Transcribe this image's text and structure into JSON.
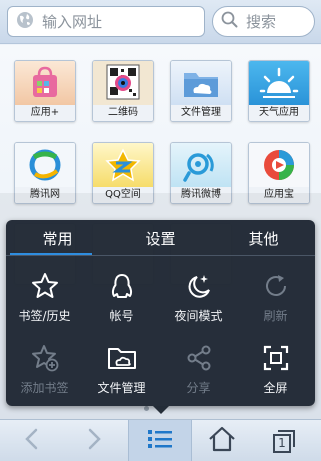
{
  "top_bar": {
    "url_placeholder": "输入网址",
    "search_placeholder": "搜索"
  },
  "home": {
    "apps": [
      {
        "label": "应用+",
        "icon": "app-plus-icon"
      },
      {
        "label": "二维码",
        "icon": "qr-code-icon"
      },
      {
        "label": "文件管理",
        "icon": "folder-cloud-icon"
      },
      {
        "label": "天气应用",
        "icon": "weather-sun-icon"
      },
      {
        "label": "腾讯网",
        "icon": "tencent-logo-icon"
      },
      {
        "label": "QQ空间",
        "icon": "qzone-star-icon"
      },
      {
        "label": "腾讯微博",
        "icon": "weibo-icon"
      },
      {
        "label": "应用宝",
        "icon": "app-treasure-icon"
      }
    ]
  },
  "menu": {
    "tabs": [
      "常用",
      "设置",
      "其他"
    ],
    "active_tab": "常用",
    "items": [
      {
        "label": "书签/历史",
        "icon": "star-icon",
        "enabled": true
      },
      {
        "label": "帐号",
        "icon": "account-icon",
        "enabled": true
      },
      {
        "label": "夜间模式",
        "icon": "night-moon-icon",
        "enabled": true
      },
      {
        "label": "刷新",
        "icon": "refresh-icon",
        "enabled": false
      },
      {
        "label": "添加书签",
        "icon": "add-bookmark-icon",
        "enabled": false
      },
      {
        "label": "文件管理",
        "icon": "folder-cloud-icon",
        "enabled": true
      },
      {
        "label": "分享",
        "icon": "share-icon",
        "enabled": false
      },
      {
        "label": "全屏",
        "icon": "fullscreen-icon",
        "enabled": true
      }
    ]
  },
  "bottom_bar": {
    "window_count": "1",
    "buttons": [
      "back-arrow-icon",
      "forward-arrow-icon",
      "menu-list-icon",
      "home-icon",
      "windows-icon"
    ]
  },
  "colors": {
    "accent": "#2e8ddf",
    "menu_bg": "#1e2632",
    "disabled_text": "#737d8a"
  }
}
